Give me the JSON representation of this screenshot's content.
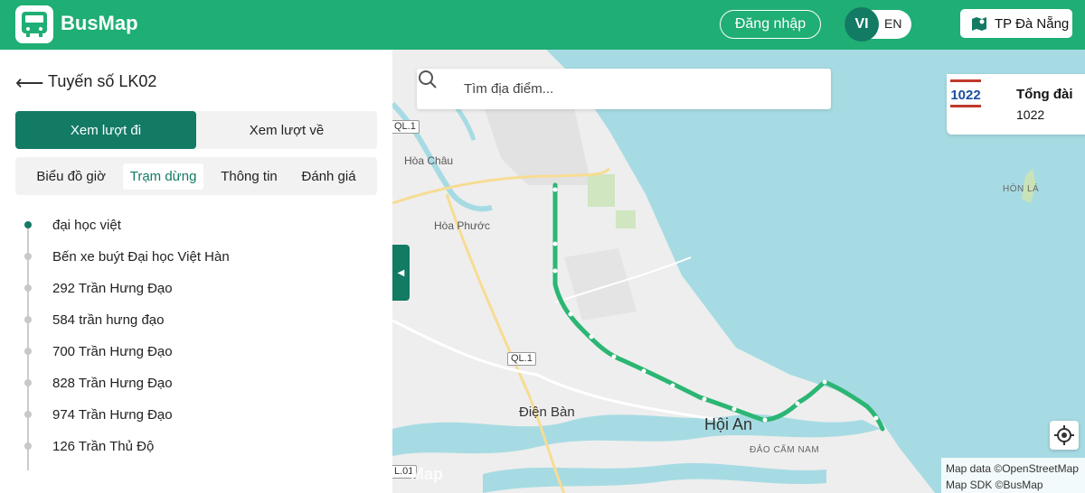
{
  "header": {
    "brand": "BusMap",
    "login_label": "Đăng nhập",
    "lang_active": "VI",
    "lang_other": "EN",
    "city_label": "TP Đà Nẵng",
    "brand_color": "#1fae74",
    "accent_color": "#137a64"
  },
  "sidebar": {
    "title": "Tuyến số LK02",
    "directions": [
      "Xem lượt đi",
      "Xem lượt về"
    ],
    "tabs": [
      "Biểu đồ giờ",
      "Trạm dừng",
      "Thông tin",
      "Đánh giá"
    ],
    "active_tab": "Trạm dừng",
    "stops": [
      "đại học việt",
      "Bến xe buýt Đại học Việt Hàn",
      "292 Trần Hưng Đạo",
      "584 trần hưng đạo",
      "700 Trần Hưng Đạo",
      "828 Trần Hưng Đạo",
      "974 Trần Hưng Đạo",
      "126 Trần Thủ Độ"
    ]
  },
  "map": {
    "search_placeholder": "Tìm địa điểm...",
    "hotline_title": "Tổng đài",
    "hotline_number": "1022",
    "hotline_logo_text": "1022",
    "labels": {
      "hoa_chau": "Hòa Châu",
      "hoa_phuoc": "Hòa Phước",
      "dien_ban": "Điện Bàn",
      "hoi_an": "Hội An",
      "hon_la": "HÒN LÁ",
      "dao_cam_nam": "ĐẢO CẨM NAM",
      "ql1_top": "QL.1",
      "ql1_mid": "QL.1",
      "ql1_bottom": "L.01"
    },
    "watermark": "Map",
    "attribution": [
      "Map data ©OpenStreetMap",
      "Map SDK ©BusMap"
    ],
    "route_color": "#2bb673"
  }
}
